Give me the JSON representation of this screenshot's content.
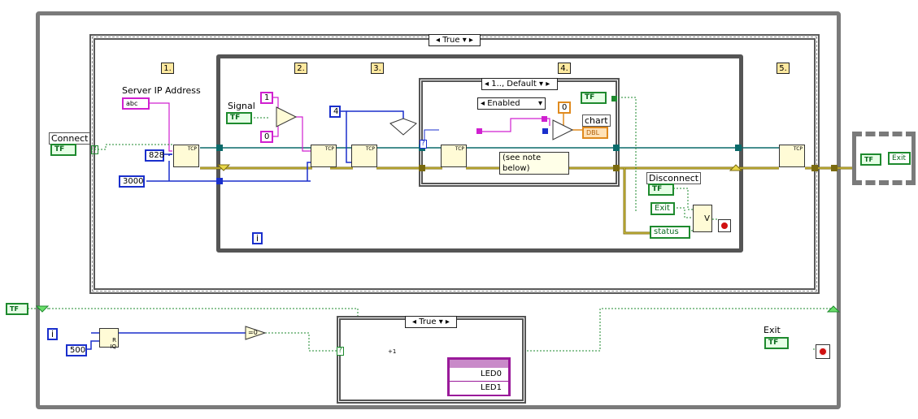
{
  "case_outer": {
    "selector": "True"
  },
  "frames": [
    "1.",
    "2.",
    "3.",
    "4.",
    "5."
  ],
  "labels": {
    "server_ip": "Server IP Address",
    "connect": "Connect",
    "signal": "Signal",
    "chart": "chart",
    "disconnect": "Disconnect",
    "exit_top": "Exit",
    "exit_bottom": "Exit",
    "status": "status",
    "note": "(see note below)"
  },
  "constants": {
    "port_828": "828",
    "port_3000": "3000",
    "const_4": "4",
    "const_1": "1",
    "const_0_pink": "0",
    "const_0_orange": "0",
    "const_500": "500",
    "iter_i": "i",
    "string_ctl": "abc",
    "dbl": "DBL",
    "bool_tf": "TF",
    "eq0": "=0",
    "v": "V",
    "rq": "R\nIQ",
    "tcp": "TCP",
    "q": "?",
    "plus_one": "+1"
  },
  "case_inner": {
    "selector": "1.., Default"
  },
  "enum_enabled": "Enabled",
  "case_bottom": {
    "selector": "True"
  },
  "leds": [
    "LED0",
    "LED1"
  ]
}
